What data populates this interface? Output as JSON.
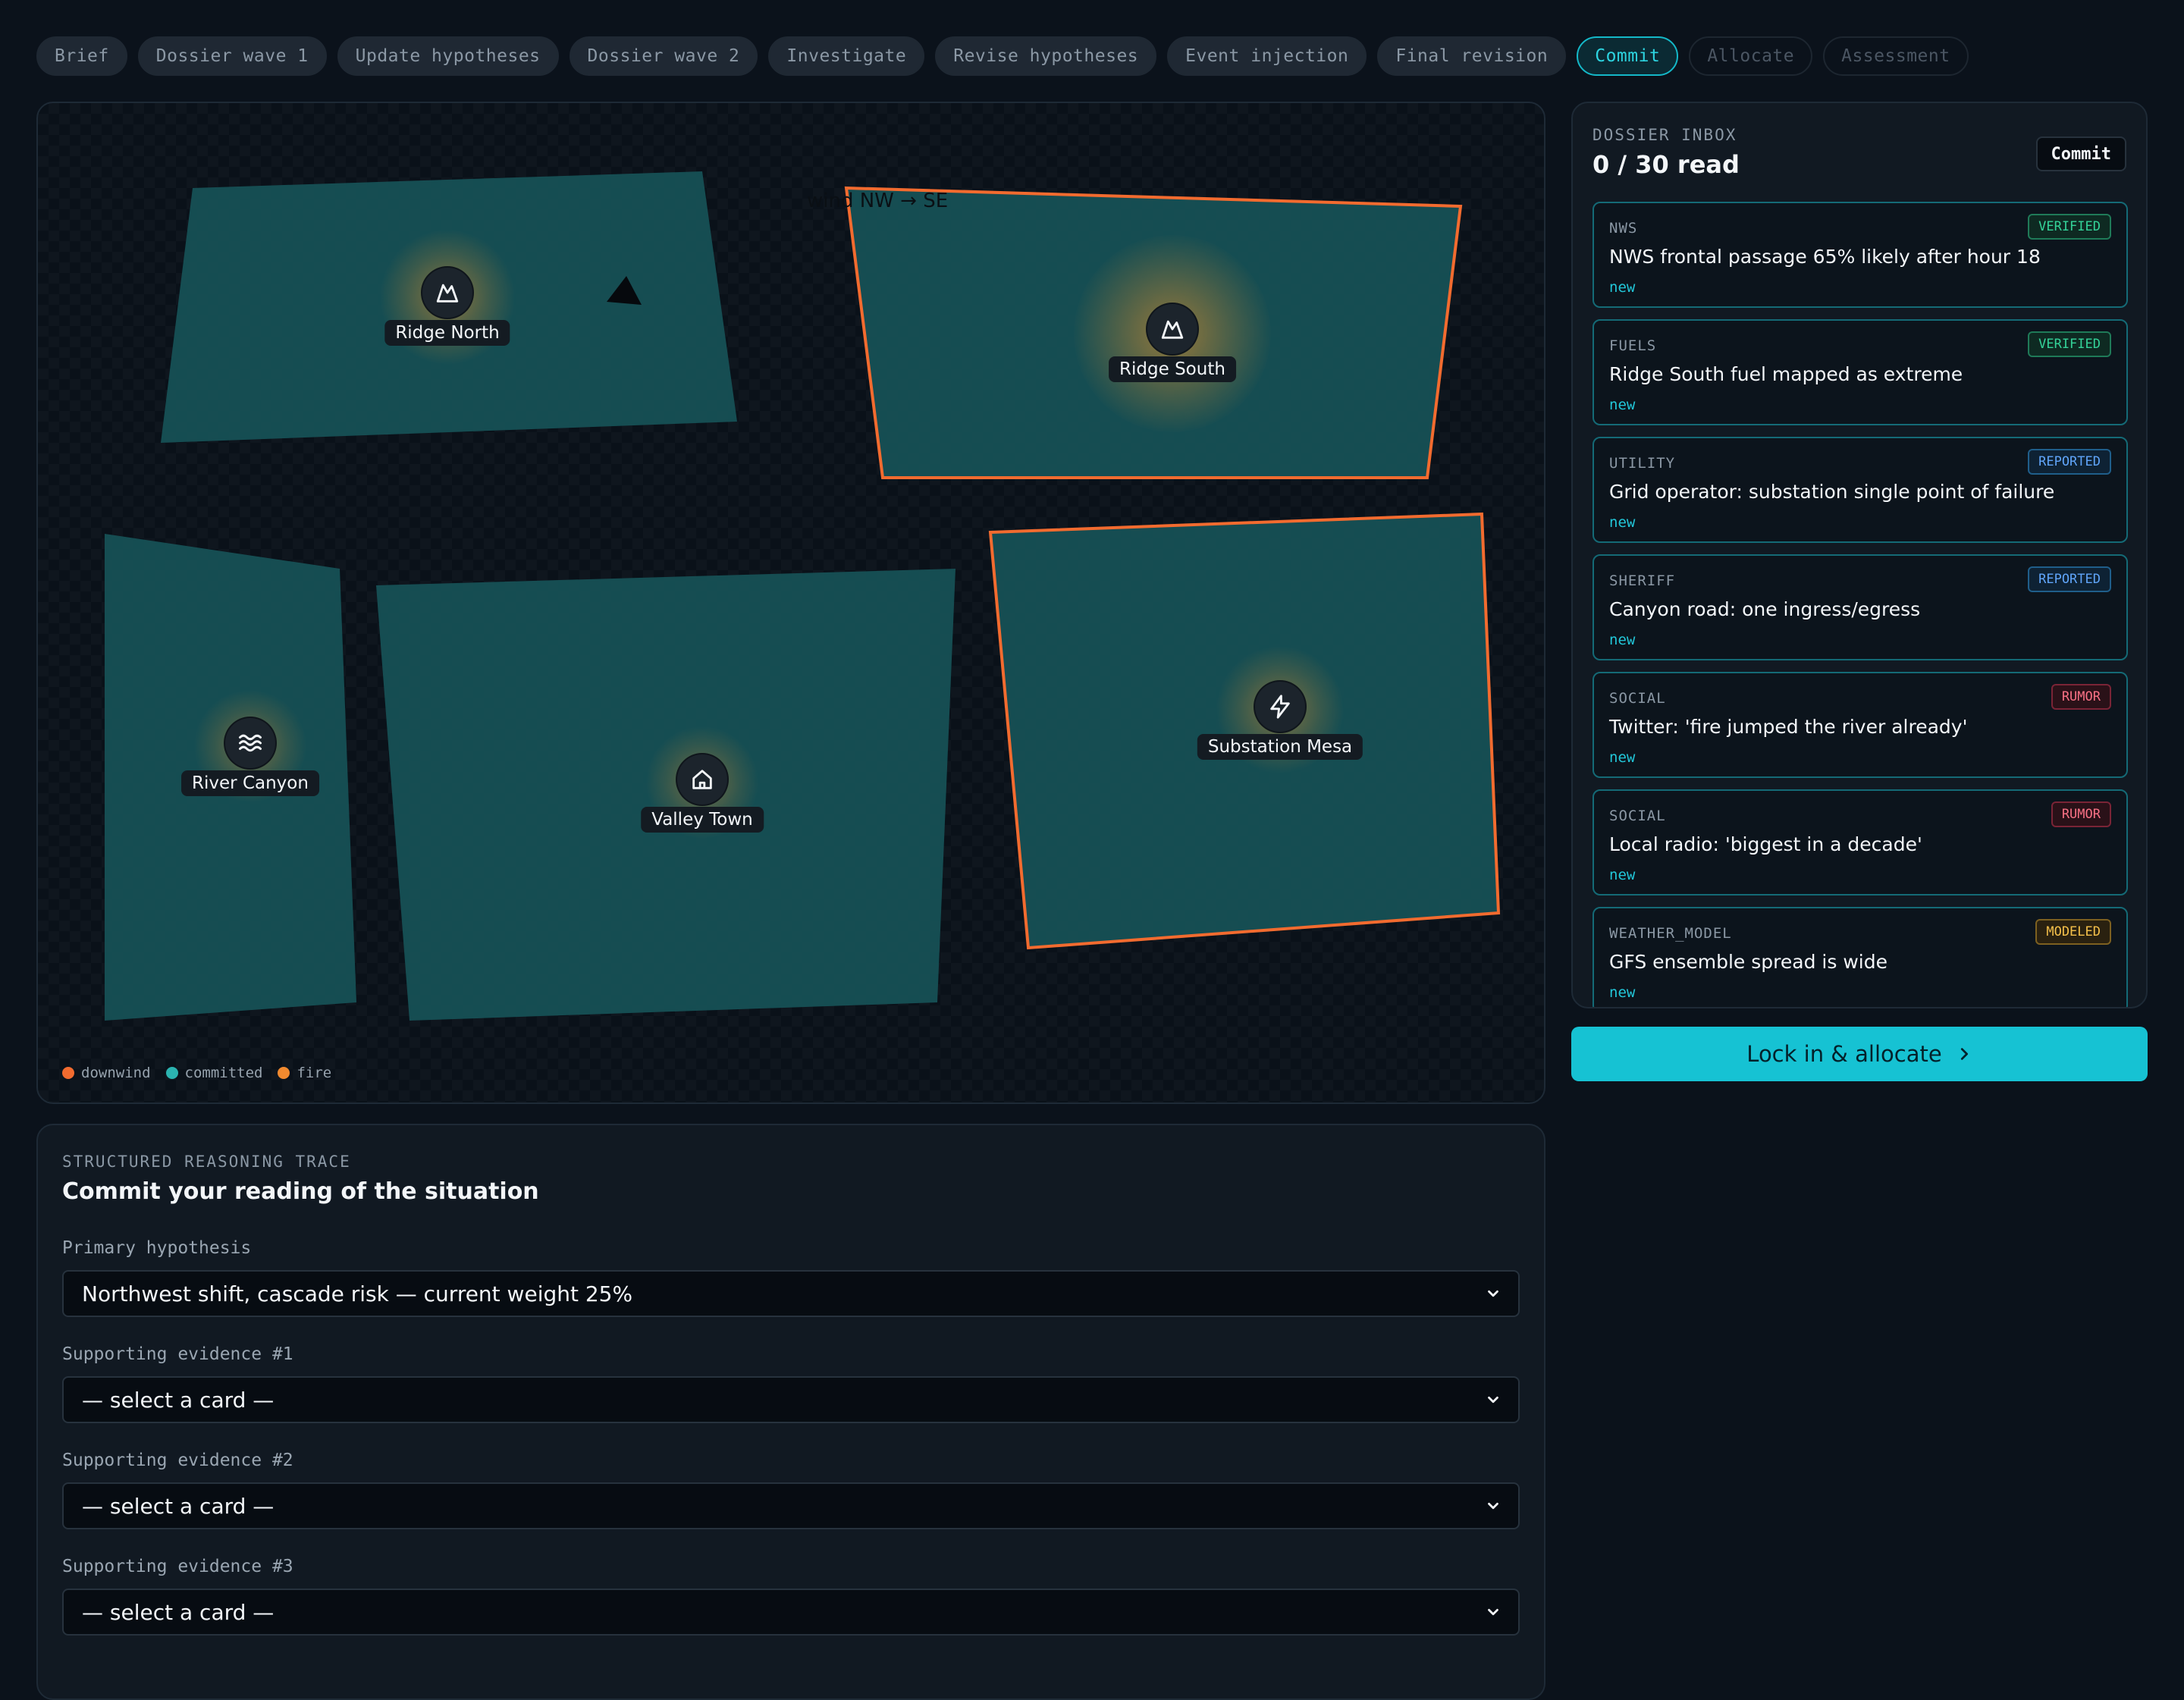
{
  "steps": {
    "items": [
      {
        "label": "Brief"
      },
      {
        "label": "Dossier wave 1"
      },
      {
        "label": "Update hypotheses"
      },
      {
        "label": "Dossier wave 2"
      },
      {
        "label": "Investigate"
      },
      {
        "label": "Revise hypotheses"
      },
      {
        "label": "Event injection"
      },
      {
        "label": "Final revision"
      },
      {
        "label": "Commit"
      },
      {
        "label": "Allocate"
      },
      {
        "label": "Assessment"
      }
    ],
    "active": "Commit"
  },
  "map": {
    "wind_label": "wind NW → SE",
    "regions": [
      {
        "label": "Ridge North",
        "icon": "mountain-icon"
      },
      {
        "label": "Ridge South",
        "icon": "mountain-icon"
      },
      {
        "label": "River Canyon",
        "icon": "waves-icon"
      },
      {
        "label": "Valley Town",
        "icon": "home-icon"
      },
      {
        "label": "Substation Mesa",
        "icon": "lightning-icon"
      }
    ],
    "legend": [
      {
        "label": "downwind",
        "color": "#f26b2f"
      },
      {
        "label": "committed",
        "color": "#2bb3b0"
      },
      {
        "label": "fire",
        "color": "#f28a2f"
      }
    ],
    "colors": {
      "region_fill": "#175257",
      "downwind_outline": "#f26b2f",
      "fire_glow": "#e8952c"
    }
  },
  "reasoning": {
    "eyebrow": "STRUCTURED REASONING TRACE",
    "title": "Commit your reading of the situation",
    "primary": {
      "label": "Primary hypothesis",
      "value": "Northwest shift, cascade risk — current weight 25%"
    },
    "evidence": [
      {
        "label": "Supporting evidence #1",
        "value": "— select a card —"
      },
      {
        "label": "Supporting evidence #2",
        "value": "— select a card —"
      },
      {
        "label": "Supporting evidence #3",
        "value": "— select a card —"
      }
    ]
  },
  "inbox": {
    "eyebrow": "DOSSIER INBOX",
    "count": "0 / 30 read",
    "badge": "Commit",
    "cards": [
      {
        "source": "NWS",
        "tag": "VERIFIED",
        "title": "NWS frontal passage 65% likely after hour 18",
        "status": "new"
      },
      {
        "source": "FUELS",
        "tag": "VERIFIED",
        "title": "Ridge South fuel mapped as extreme",
        "status": "new"
      },
      {
        "source": "UTILITY",
        "tag": "REPORTED",
        "title": "Grid operator: substation single point of failure",
        "status": "new"
      },
      {
        "source": "SHERIFF",
        "tag": "REPORTED",
        "title": "Canyon road: one ingress/egress",
        "status": "new"
      },
      {
        "source": "SOCIAL",
        "tag": "RUMOR",
        "title": "Twitter: 'fire jumped the river already'",
        "status": "new"
      },
      {
        "source": "SOCIAL",
        "tag": "RUMOR",
        "title": "Local radio: 'biggest in a decade'",
        "status": "new"
      },
      {
        "source": "WEATHER_MODEL",
        "tag": "MODELED",
        "title": "GFS ensemble spread is wide",
        "status": "new"
      }
    ]
  },
  "actions": {
    "lock_label": "Lock in & allocate"
  }
}
